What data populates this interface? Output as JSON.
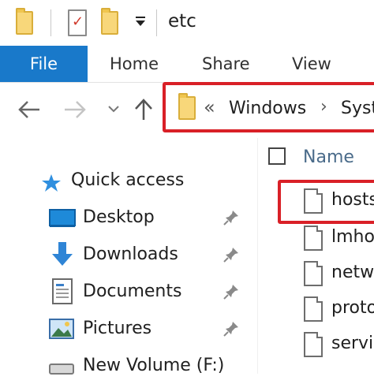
{
  "window": {
    "title": "etc"
  },
  "ribbon": {
    "tabs": [
      {
        "label": "File"
      },
      {
        "label": "Home"
      },
      {
        "label": "Share"
      },
      {
        "label": "View"
      }
    ]
  },
  "address_bar": {
    "overflow_glyph": "«",
    "crumbs": [
      "Windows",
      "Syst"
    ],
    "separator": "›"
  },
  "nav_pane": {
    "items": [
      {
        "label": "Quick access",
        "icon": "star-icon",
        "pinned": false
      },
      {
        "label": "Desktop",
        "icon": "desktop-icon",
        "pinned": true
      },
      {
        "label": "Downloads",
        "icon": "download-arrow-icon",
        "pinned": true
      },
      {
        "label": "Documents",
        "icon": "documents-icon",
        "pinned": true
      },
      {
        "label": "Pictures",
        "icon": "pictures-icon",
        "pinned": true
      },
      {
        "label": "New Volume (F:)",
        "icon": "drive-icon",
        "pinned": false
      }
    ]
  },
  "file_list": {
    "column_header": "Name",
    "files": [
      {
        "label": "hosts",
        "highlighted": true
      },
      {
        "label": "lmho"
      },
      {
        "label": "netw"
      },
      {
        "label": "proto"
      },
      {
        "label": "servic"
      }
    ]
  },
  "colors": {
    "accent": "#1979ca",
    "highlight": "#d92027",
    "folder": "#f8d77a"
  }
}
